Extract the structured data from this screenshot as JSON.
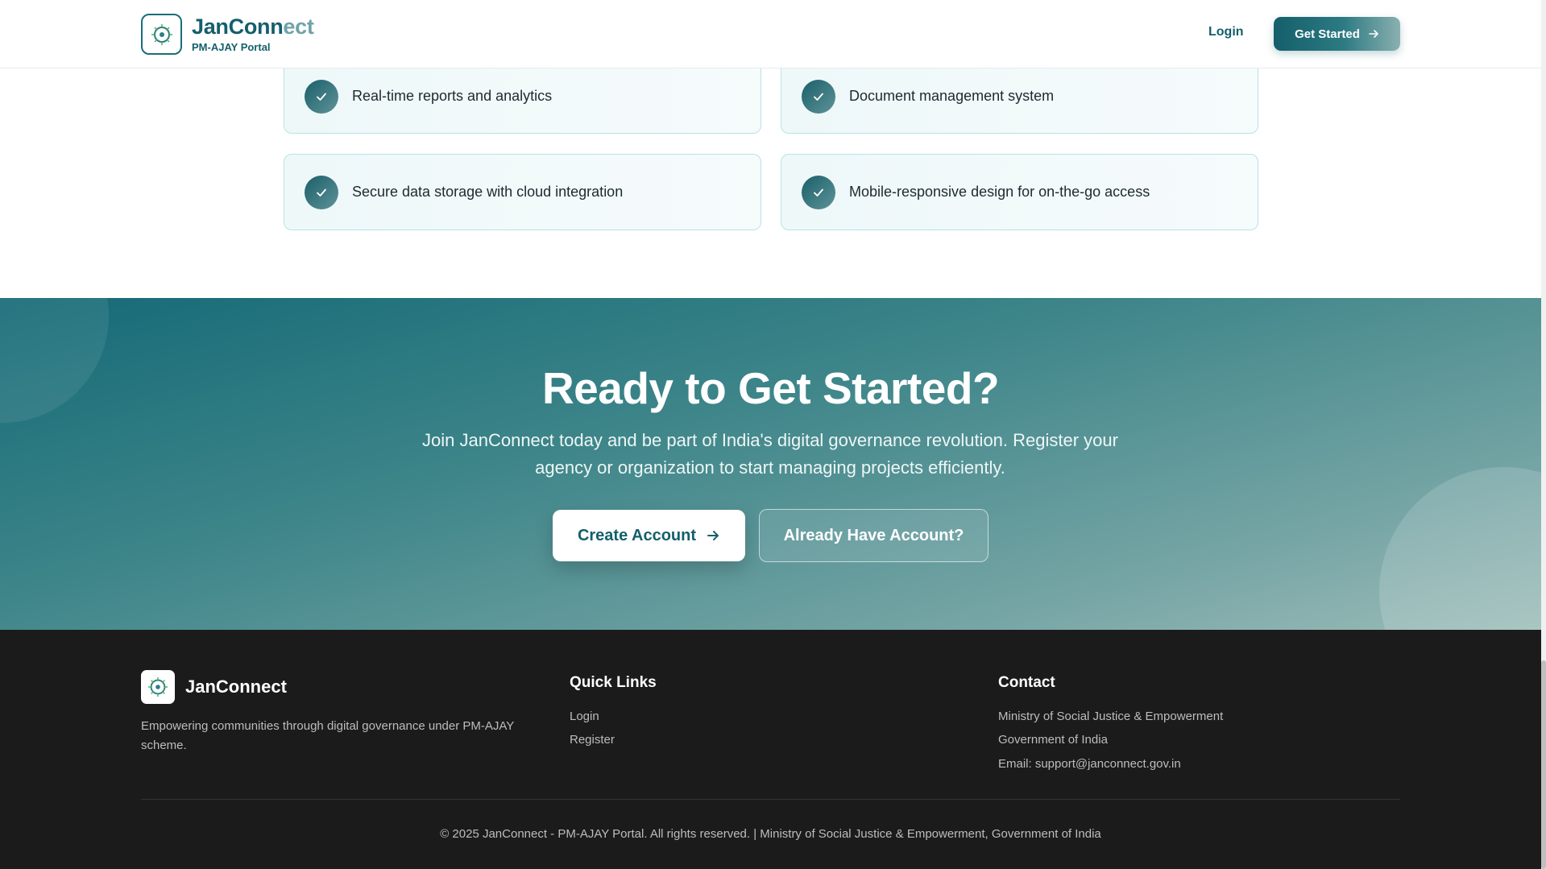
{
  "header": {
    "brand_main": "JanConn",
    "brand_fade": "ect",
    "subtitle": "PM-AJAY Portal",
    "login_label": "Login",
    "get_started_label": "Get Started"
  },
  "features": [
    {
      "label": "Real-time reports and analytics"
    },
    {
      "label": "Document management system"
    },
    {
      "label": "Secure data storage with cloud integration"
    },
    {
      "label": "Mobile-responsive design for on-the-go access"
    }
  ],
  "cta": {
    "title": "Ready to Get Started?",
    "description": "Join JanConnect today and be part of India's digital governance revolution. Register your agency or organization to start managing projects efficiently.",
    "create_account_label": "Create Account",
    "have_account_label": "Already Have Account?"
  },
  "footer": {
    "brand": "JanConnect",
    "description": "Empowering communities through digital governance under PM-AJAY scheme.",
    "quick_links_heading": "Quick Links",
    "quick_links": [
      "Login",
      "Register"
    ],
    "contact_heading": "Contact",
    "contact_lines": [
      "Ministry of Social Justice & Empowerment",
      "Government of India",
      "Email: support@janconnect.gov.in"
    ],
    "copyright": "© 2025 JanConnect - PM-AJAY Portal. All rights reserved. | Ministry of Social Justice & Empowerment, Government of India"
  },
  "icons": {
    "logo": "chakra-logo-icon",
    "check": "check-icon",
    "arrow": "arrow-right-icon"
  },
  "colors": {
    "brand_teal": "#145f6b",
    "footer_bg": "#1b1b1b",
    "card_border": "#b9e2e6"
  }
}
